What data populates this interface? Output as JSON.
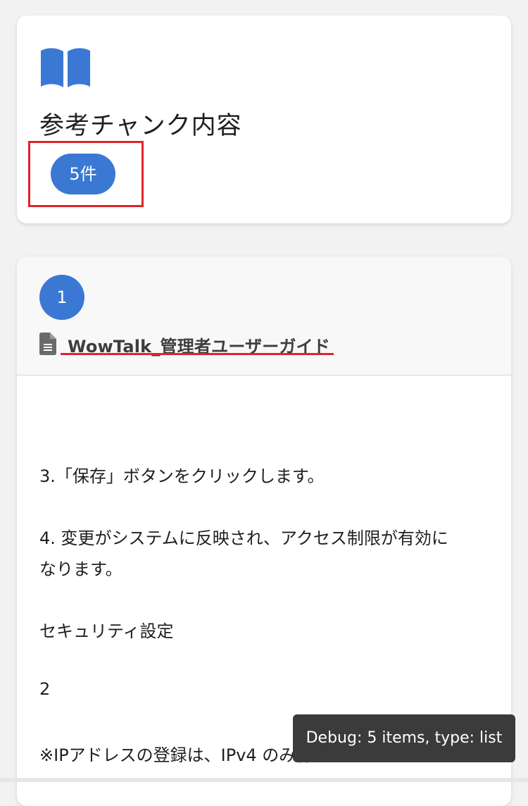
{
  "header": {
    "icon": "book-open-icon",
    "title": "参考チャンク内容",
    "count_badge": "5件"
  },
  "chunk": {
    "number": "1",
    "doc_icon": "document-icon",
    "doc_title": "WowTalk_管理者ユーザーガイド",
    "lines": [
      "3.「保存」ボタンをクリックします。",
      "4. 変更がシステムに反映され、アクセス制限が有効に",
      "なります。",
      "セキュリティ設定",
      "2",
      "※IPアドレスの登録は、IPv4 のみ行うことができま"
    ]
  },
  "debug": {
    "text": "Debug: 5 items, type: list"
  },
  "colors": {
    "accent": "#3a78d4",
    "highlight_red": "#e0232b",
    "toast_bg": "#3b3b3b"
  }
}
